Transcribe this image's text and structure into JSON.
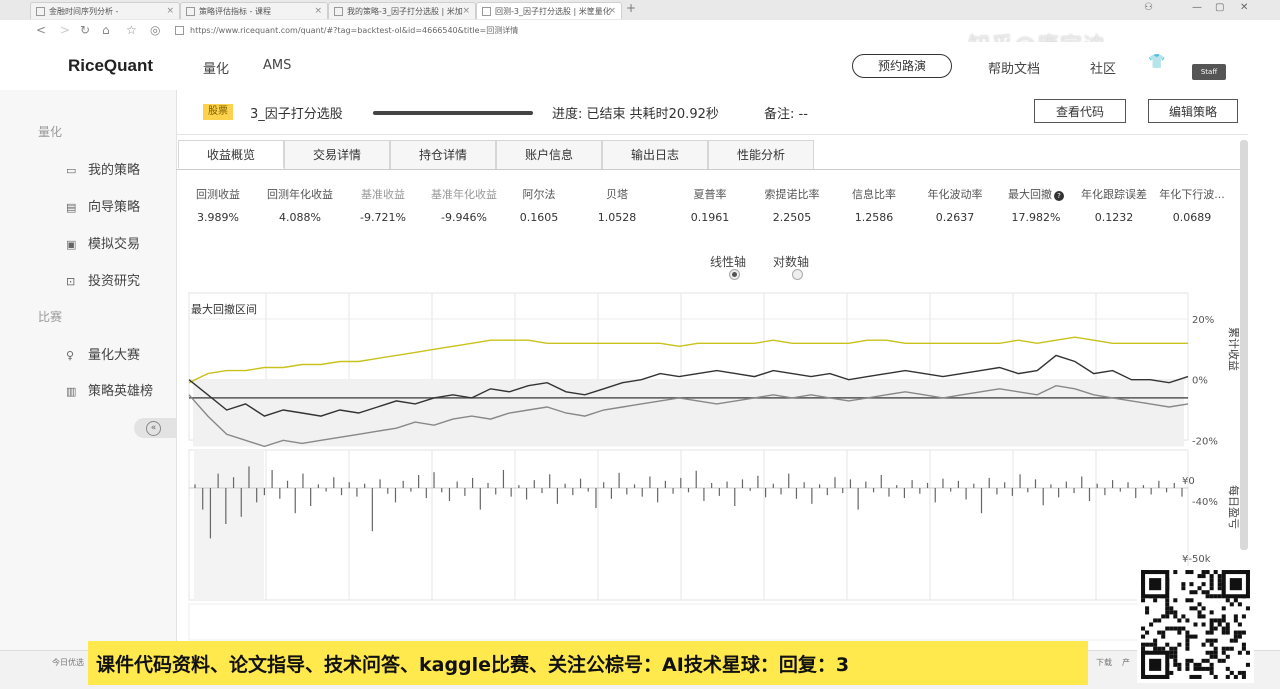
{
  "browser": {
    "tabs": [
      {
        "label": "金融时间序列分析 -",
        "active": false
      },
      {
        "label": "策略评估指标 - 课程",
        "active": false
      },
      {
        "label": "我的策略-3_因子打分选股 | 米加",
        "active": false
      },
      {
        "label": "回测-3_因子打分选股 | 米筐量化",
        "active": true
      }
    ],
    "url": "https://www.ricequant.com/quant/#?tag=backtest-ol&id=4666540&title=回测详情",
    "watermark": "知乎@唐宇迪-"
  },
  "header": {
    "logo": "RiceQuant",
    "nav": [
      "量化",
      "AMS"
    ],
    "demo_button": "预约路演",
    "help": "帮助文档",
    "community": "社区",
    "staff": "Staff"
  },
  "sidebar": {
    "section1": "量化",
    "items1": [
      {
        "label": "我的策略",
        "icon": "chart-window-icon"
      },
      {
        "label": "向导策略",
        "icon": "wizard-icon"
      },
      {
        "label": "模拟交易",
        "icon": "trade-icon"
      },
      {
        "label": "投资研究",
        "icon": "research-icon"
      }
    ],
    "section2": "比赛",
    "items2": [
      {
        "label": "量化大赛",
        "icon": "trophy-icon"
      },
      {
        "label": "策略英雄榜",
        "icon": "leaderboard-icon"
      }
    ]
  },
  "strategy": {
    "badge": "股票",
    "name": "3_因子打分选股",
    "progress": "进度: 已结束 共耗时20.92秒",
    "progress_fraction": 1.0,
    "notes": "备注: --",
    "view_code": "查看代码",
    "edit_strategy": "编辑策略"
  },
  "tabs": [
    "收益概览",
    "交易详情",
    "持仓详情",
    "账户信息",
    "输出日志",
    "性能分析"
  ],
  "metrics": [
    {
      "label": "回测收益",
      "value": "3.989%",
      "muted": false
    },
    {
      "label": "回测年化收益",
      "value": "4.088%",
      "muted": false
    },
    {
      "label": "基准收益",
      "value": "-9.721%",
      "muted": true
    },
    {
      "label": "基准年化收益",
      "value": "-9.946%",
      "muted": true
    },
    {
      "label": "阿尔法",
      "value": "0.1605",
      "muted": false
    },
    {
      "label": "贝塔",
      "value": "1.0528",
      "muted": false
    },
    {
      "label": "夏普率",
      "value": "0.1961",
      "muted": false
    },
    {
      "label": "索提诺比率",
      "value": "2.2505",
      "muted": false
    },
    {
      "label": "信息比率",
      "value": "1.2586",
      "muted": false
    },
    {
      "label": "年化波动率",
      "value": "0.2637",
      "muted": false
    },
    {
      "label": "最大回撤",
      "value": "17.982%",
      "muted": false,
      "badge": "?"
    },
    {
      "label": "年化跟踪误差",
      "value": "0.1232",
      "muted": false
    },
    {
      "label": "年化下行波...",
      "value": "0.0689",
      "muted": false
    }
  ],
  "axis_toggle": {
    "linear": "线性轴",
    "log": "对数轴",
    "selected": "linear"
  },
  "chart_data": [
    {
      "type": "line",
      "annotation": "最大回撤区间",
      "ylabel": "累计收益",
      "yticks": [
        "20%",
        "0%",
        "-20%",
        "-40%"
      ],
      "ylim": [
        -40,
        20
      ],
      "grid": true,
      "series": [
        {
          "color": "#c9c21c",
          "values": [
            -1,
            2,
            3,
            3,
            4,
            4,
            5,
            5,
            6,
            6,
            7,
            8,
            9,
            10,
            11,
            12,
            13,
            13,
            13,
            12,
            12,
            12,
            12,
            12,
            12,
            12,
            11,
            12,
            12,
            12,
            12,
            13,
            12,
            12,
            12,
            12,
            13,
            13,
            12,
            12,
            12,
            12,
            12,
            12,
            13,
            12,
            13,
            14,
            13,
            12,
            12,
            12,
            12,
            12
          ]
        },
        {
          "color": "#333333",
          "values": [
            0,
            -5,
            -10,
            -8,
            -12,
            -10,
            -11,
            -12,
            -10,
            -11,
            -9,
            -7,
            -8,
            -6,
            -5,
            -6,
            -3,
            -4,
            -2,
            -1,
            -4,
            -5,
            -3,
            -1,
            0,
            2,
            1,
            2,
            3,
            2,
            1,
            3,
            2,
            1,
            2,
            0,
            1,
            2,
            3,
            2,
            1,
            2,
            3,
            4,
            2,
            3,
            8,
            6,
            2,
            3,
            0,
            0,
            -1,
            1
          ]
        },
        {
          "color": "#888888",
          "values": [
            -5,
            -12,
            -18,
            -20,
            -22,
            -20,
            -21,
            -20,
            -19,
            -18,
            -17,
            -16,
            -14,
            -15,
            -13,
            -12,
            -13,
            -11,
            -10,
            -9,
            -11,
            -12,
            -10,
            -9,
            -8,
            -7,
            -6,
            -7,
            -8,
            -7,
            -6,
            -5,
            -6,
            -5,
            -6,
            -7,
            -6,
            -5,
            -4,
            -5,
            -6,
            -5,
            -4,
            -3,
            -4,
            -5,
            -2,
            -3,
            -5,
            -6,
            -7,
            -8,
            -9,
            -8
          ]
        }
      ]
    },
    {
      "type": "bar",
      "ylabel": "每日盈亏",
      "yticks": [
        "¥0",
        "¥-50k"
      ],
      "ylim": [
        -80,
        40
      ],
      "grid": true,
      "values": [
        5,
        -30,
        -70,
        20,
        -50,
        15,
        -40,
        30,
        -20,
        -10,
        25,
        -15,
        10,
        -35,
        20,
        -25,
        5,
        -5,
        15,
        -10,
        8,
        -12,
        6,
        -60,
        12,
        -8,
        -20,
        10,
        -5,
        18,
        -14,
        22,
        -6,
        -18,
        9,
        -11,
        14,
        -30,
        7,
        -9,
        25,
        -12,
        4,
        -16,
        11,
        -7,
        19,
        -22,
        6,
        -10,
        13,
        -5,
        -28,
        8,
        -15,
        21,
        -9,
        5,
        -12,
        16,
        -20,
        10,
        -8,
        14,
        -6,
        24,
        -18,
        7,
        -11,
        9,
        -25,
        12,
        -4,
        17,
        -13,
        6,
        -9,
        20,
        -15,
        8,
        -22,
        5,
        -10,
        15,
        -7,
        12,
        -30,
        9,
        -6,
        18,
        -12,
        4,
        -14,
        11,
        -8,
        7,
        -20,
        13,
        -5,
        10,
        -16,
        6,
        -35,
        14,
        -9,
        8,
        -11,
        19,
        -6,
        12,
        -24,
        5,
        -13,
        9,
        -7,
        16,
        -18,
        6,
        -10,
        11,
        -5,
        8,
        -14,
        4,
        -9,
        10,
        -6,
        7,
        -12
      ]
    }
  ],
  "banner": "课件代码资料、论文指导、技术问答、kaggle比赛、关注公棕号：AI技术星球：回复：3",
  "status": {
    "left": "今日优选",
    "right": [
      "下载",
      "产"
    ]
  }
}
